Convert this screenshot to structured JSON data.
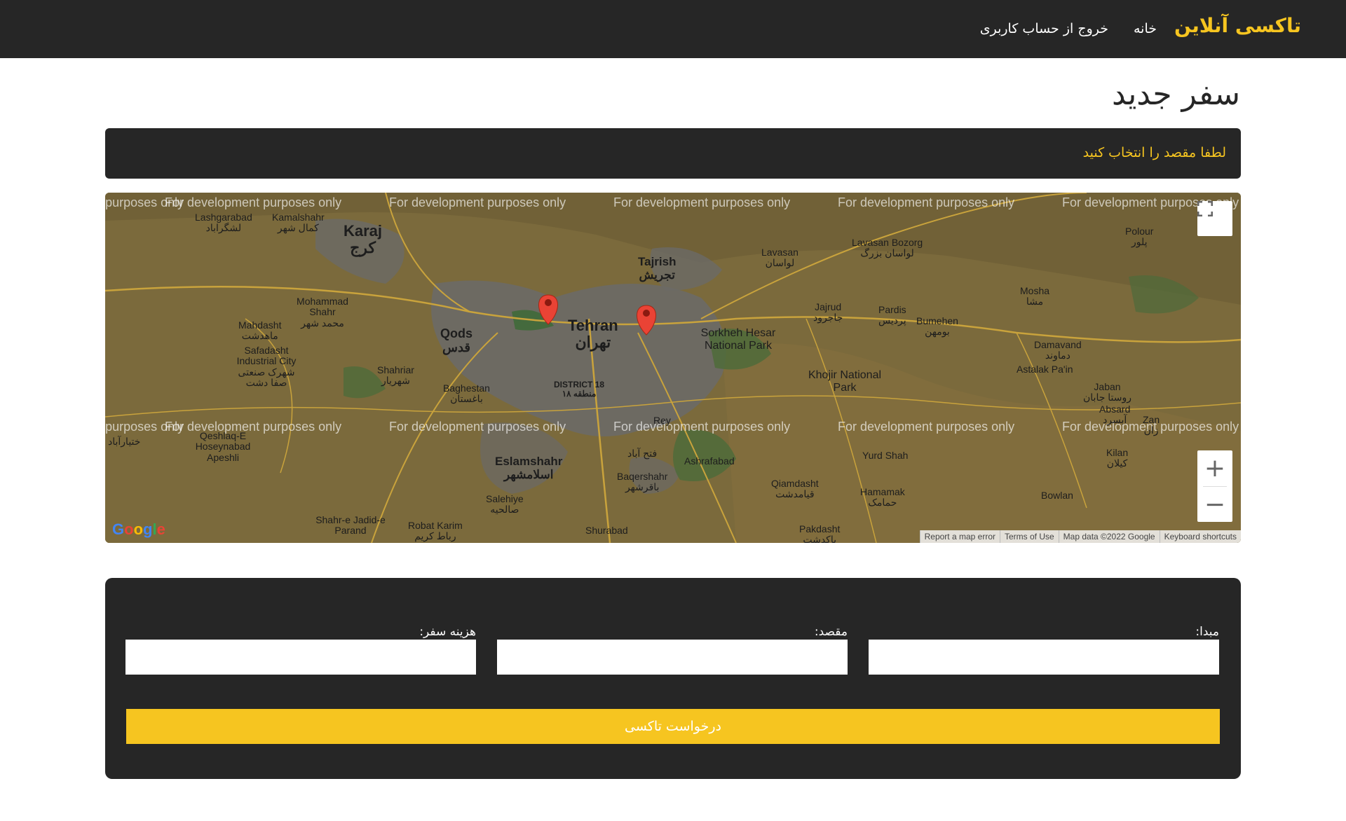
{
  "nav": {
    "brand": "تاکسی آنلاین",
    "home": "خانه",
    "logout": "خروج از حساب کاربری"
  },
  "page": {
    "title": "سفر جدید",
    "alert": "لطفا مقصد را انتخاب کنید"
  },
  "map": {
    "watermark": "For development purposes only",
    "google_logo": "Google",
    "attribution": [
      "Report a map error",
      "Terms of Use",
      "Map data ©2022 Google",
      "Keyboard shortcuts"
    ],
    "zoom_in": "+",
    "zoom_out": "−",
    "places": {
      "tehran": "Tehran",
      "tehran_fa": "تهران",
      "karaj": "Karaj",
      "karaj_fa": "کرج",
      "tajrish": "Tajrish",
      "tajrish_fa": "تجریش",
      "qods": "Qods",
      "qods_fa": "قدس",
      "eslamshahr": "Eslamshahr",
      "eslamshahr_fa": "اسلامشهر",
      "lavasan": "Lavasan",
      "lavasan_fa": "لواسان",
      "pardis": "Pardis",
      "pardis_fa": "پردیس",
      "sorkheh_hesar": "Sorkheh Hesar National Park",
      "khojir": "Khojir National Park",
      "damavand": "Damavand",
      "damavand_fa": "دماوند",
      "astalak": "Astalak Pa'in",
      "mohammad_shahr": "Mohammad Shahr",
      "mohammad_shahr_fa": "محمد شهر",
      "mahdasht": "Mahdasht",
      "mahdasht_fa": "ماهدشت",
      "safadasht": "Safadasht Industrial City",
      "safadasht_fa": "شهرک صنعتی صفا دشت",
      "shahriar": "Shahriar",
      "shahriar_fa": "شهریار",
      "baghestan": "Baghestan",
      "baghestan_fa": "باغستان",
      "district18": "DISTRICT 18",
      "district18_fa": "منطقه ۱۸",
      "rey": "Rey",
      "fath": "فتح آباد",
      "ashrafabad": "Ashrafabad",
      "baqershahr": "Baqershahr",
      "baqershahr_fa": "باقرشهر",
      "salehiye": "Salehiye",
      "salehiye_fa": "صالحیه",
      "qiamdasht": "Qiamdasht",
      "qiamdasht_fa": "قیامدشت",
      "yurd_shah": "Yurd Shah",
      "hamamak": "Hamamak",
      "hamamak_fa": "حمامک",
      "lashgarabad": "Lashgarabad",
      "lashgarabad_fa": "لشگراباد",
      "kamalshahr": "Kamalshahr",
      "kamalshahr_fa": "کمال شهر",
      "polour": "Polour",
      "polour_fa": "پلور",
      "lavasan_bozorg": "Lavasan Bozorg",
      "lavasan_bozorg_fa": "لواسان بزرگ",
      "mosha": "Mosha",
      "mosha_fa": "مشا",
      "jajrud": "Jajrud",
      "jajrud_fa": "جاجرود",
      "bumehen": "Bumehen",
      "bumehen_fa": "بومهن",
      "jaban": "Jaban",
      "jaban_fa": "روستا جابان",
      "absard": "Absard",
      "absard_fa": "آبسرد",
      "zan": "Zan",
      "zan_fa": "زان",
      "kilan": "Kilan",
      "kilan_fa": "کیلان",
      "bowlan": "Bowlan",
      "qeshlaq": "Qeshlaq-E Hoseynabad Apeshli",
      "robat_karim": "Robat Karim",
      "robat_karim_fa": "رباط کریم",
      "shahr_e_jadid": "Shahr-e Jadid-e Parand",
      "shurabad": "Shurabad",
      "pakdasht": "Pakdasht",
      "pakdasht_fa": "پاکدشت",
      "ekhtiarabad": "ختیارآباد"
    }
  },
  "form": {
    "origin_label": "مبدا:",
    "destination_label": "مقصد:",
    "cost_label": "هزینه سفر:",
    "submit_label": "درخواست تاکسی"
  },
  "colors": {
    "dark": "#262626",
    "accent": "#f6c520"
  }
}
